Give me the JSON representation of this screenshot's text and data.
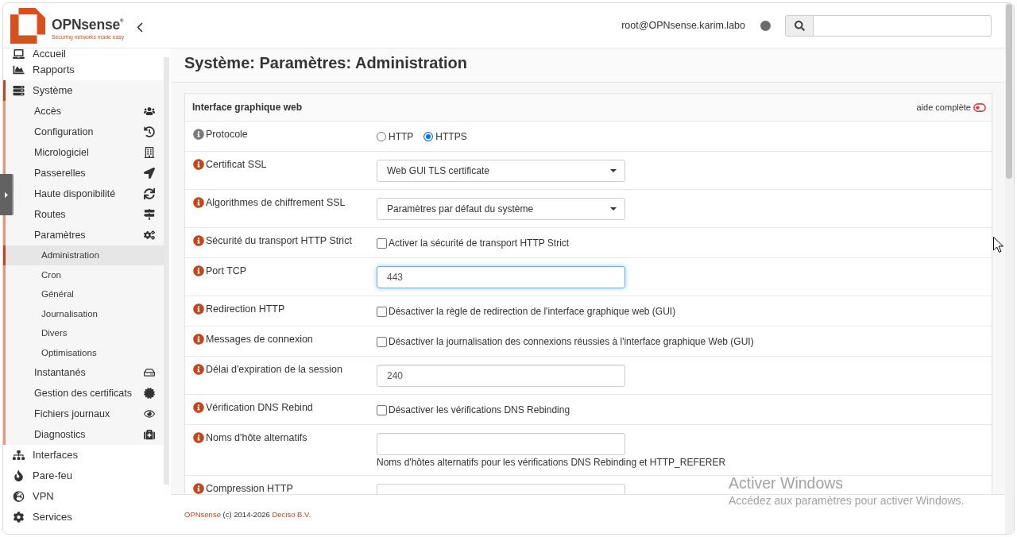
{
  "header": {
    "logo": {
      "name": "OPNsense$^{®}$",
      "tagline": "Securing networks made easy"
    },
    "user": "root@OPNsense.karim.labo"
  },
  "sidebar": {
    "items": [
      {
        "label": "Accueil",
        "selected": false
      },
      {
        "label": "Rapports",
        "selected": false
      },
      {
        "label": "Système",
        "selected": true,
        "children": [
          {
            "label": "Accès",
            "selected": false
          },
          {
            "label": "Configuration",
            "selected": false
          },
          {
            "label": "Micrologiciel",
            "selected": false
          },
          {
            "label": "Passerelles",
            "selected": false
          },
          {
            "label": "Haute disponibilité",
            "selected": false
          },
          {
            "label": "Routes",
            "selected": false
          },
          {
            "label": "Paramètres",
            "selected": false,
            "children": [
              {
                "label": "Administration",
                "selected": true
              },
              {
                "label": "Cron",
                "selected": false
              },
              {
                "label": "Général",
                "selected": false
              },
              {
                "label": "Journalisation",
                "selected": false
              },
              {
                "label": "Divers",
                "selected": false
              },
              {
                "label": "Optimisations",
                "selected": false
              }
            ]
          },
          {
            "label": "Instantanés",
            "selected": false
          },
          {
            "label": "Gestion des certificats",
            "selected": false
          },
          {
            "label": "Fichiers journaux",
            "selected": false
          },
          {
            "label": "Diagnostics",
            "selected": false
          }
        ]
      },
      {
        "label": "Interfaces",
        "selected": false
      },
      {
        "label": "Pare-feu",
        "selected": false
      },
      {
        "label": "VPN",
        "selected": false
      },
      {
        "label": "Services",
        "selected": false
      }
    ]
  },
  "page_title": "Système: Paramètres: Administration",
  "panel": {
    "title": "Interface graphique web",
    "help_toggle": {
      "label": "aide complète",
      "on": false
    },
    "rows": [
      {
        "label": "Protocole",
        "color": "#7a7a7a",
        "kind": "radio",
        "options": [
          {
            "label": "HTTP",
            "selected": false
          },
          {
            "label": "HTTPS",
            "selected": true
          }
        ]
      },
      {
        "label": "Certificat SSL",
        "color": "#c4461b",
        "kind": "select",
        "value": "Web GUI TLS certificate"
      },
      {
        "label": "Algorithmes de chiffrement SSL",
        "color": "#c4461b",
        "kind": "select",
        "value": "Paramètres par défaut du système"
      },
      {
        "label": "Sécurité du transport HTTP Strict",
        "color": "#c4461b",
        "kind": "checkbox",
        "checked": false,
        "text": "Activer la sécurité de transport HTTP Strict"
      },
      {
        "label": "Port TCP",
        "color": "#c4461b",
        "kind": "input",
        "value": "443",
        "focused": true
      },
      {
        "label": "Redirection HTTP",
        "color": "#c4461b",
        "kind": "checkbox",
        "checked": false,
        "text": "Désactiver la règle de redirection de l'interface graphique web (GUI)"
      },
      {
        "label": "Messages de connexion",
        "color": "#c4461b",
        "kind": "checkbox",
        "checked": false,
        "text": "Désactiver la journalisation des connexions réussies à l'interface graphique Web (GUI)"
      },
      {
        "label": "Délai d'expiration de la session",
        "color": "#c4461b",
        "kind": "input",
        "value": "240",
        "focused": false
      },
      {
        "label": "Vérification DNS Rebind",
        "color": "#c4461b",
        "kind": "checkbox",
        "checked": false,
        "text": "Désactiver les vérifications DNS Rebinding"
      },
      {
        "label": "Noms d'hôte alternatifs",
        "color": "#c4461b",
        "kind": "input",
        "focused": false,
        "help_text": "Noms d'hôtes alternatifs pour les vérifications DNS Rebinding et HTTP_REFERER"
      },
      {
        "label": "Compression HTTP",
        "color": "#c4461b",
        "kind": "select"
      }
    ]
  },
  "footer": {
    "parts": [
      {
        "kind": "link",
        "text": "OPNsense"
      },
      {
        "kind": "text",
        "text": "(c) 2014-2026"
      },
      {
        "kind": "link",
        "text": "Deciso B.V."
      }
    ]
  },
  "os_notice": {
    "title": "Activer Windows",
    "text": "Accédez aux paramètres pour activer Windows."
  }
}
